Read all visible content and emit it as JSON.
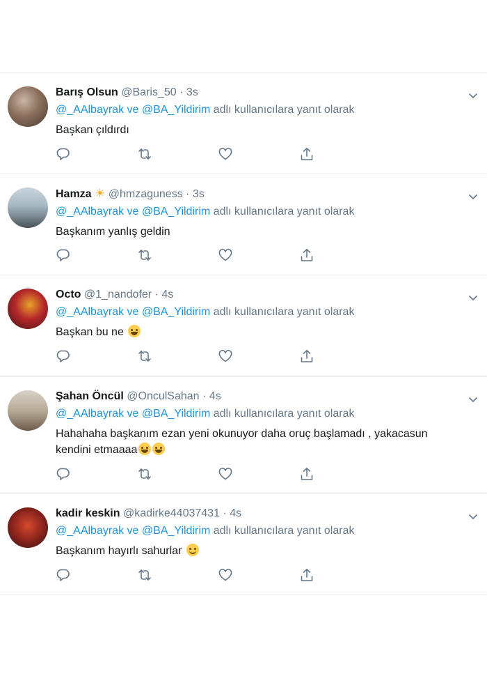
{
  "tweets": [
    {
      "name": "Barış Olsun",
      "handle": "@Baris_50",
      "separator": "·",
      "time": "3s",
      "reply_mention_1": "@_AAlbayrak",
      "reply_and": "ve",
      "reply_mention_2": "@BA_Yildirim",
      "reply_suffix": "adlı kullanıcılara yanıt olarak",
      "text": "Başkan çıldırdı"
    },
    {
      "name": "Hamza",
      "name_emoji": "☀",
      "handle": "@hmzaguness",
      "separator": "·",
      "time": "3s",
      "reply_mention_1": "@_AAlbayrak",
      "reply_and": "ve",
      "reply_mention_2": "@BA_Yildirim",
      "reply_suffix": "adlı kullanıcılara yanıt olarak",
      "text": "Başkanım yanlış geldin"
    },
    {
      "name": "Octo",
      "handle": "@1_nandofer",
      "separator": "·",
      "time": "4s",
      "reply_mention_1": "@_AAlbayrak",
      "reply_and": "ve",
      "reply_mention_2": "@BA_Yildirim",
      "reply_suffix": "adlı kullanıcılara yanıt olarak",
      "text": "Başkan bu ne",
      "text_emoji": "tears-of-joy-emoji"
    },
    {
      "name": "Şahan Öncül",
      "handle": "@OnculSahan",
      "separator": "·",
      "time": "4s",
      "reply_mention_1": "@_AAlbayrak",
      "reply_and": "ve",
      "reply_mention_2": "@BA_Yildirim",
      "reply_suffix": "adlı kullanıcılara yanıt olarak",
      "text_line1": "Hahahaha başkanım ezan yeni okunuyor daha oruç başlamadı , yakacasun",
      "text_line2": "kendini etmaaaa",
      "text_emoji": "tears-of-joy-emoji"
    },
    {
      "name": "kadir keskin",
      "handle": "@kadirke44037431",
      "separator": "·",
      "time": "4s",
      "reply_mention_1": "@_AAlbayrak",
      "reply_and": "ve",
      "reply_mention_2": "@BA_Yildirim",
      "reply_suffix": "adlı kullanıcılara yanıt olarak",
      "text": "Başkanım hayırlı sahurlar",
      "text_emoji": "smiling-face-emoji"
    }
  ],
  "icons": {
    "reply": "reply-icon",
    "retweet": "retweet-icon",
    "like": "heart-icon",
    "share": "share-icon",
    "more": "chevron-down-icon"
  },
  "colors": {
    "link": "#1b95e0",
    "muted": "#657786",
    "text": "#14171a",
    "divider": "#e6ecf0"
  }
}
